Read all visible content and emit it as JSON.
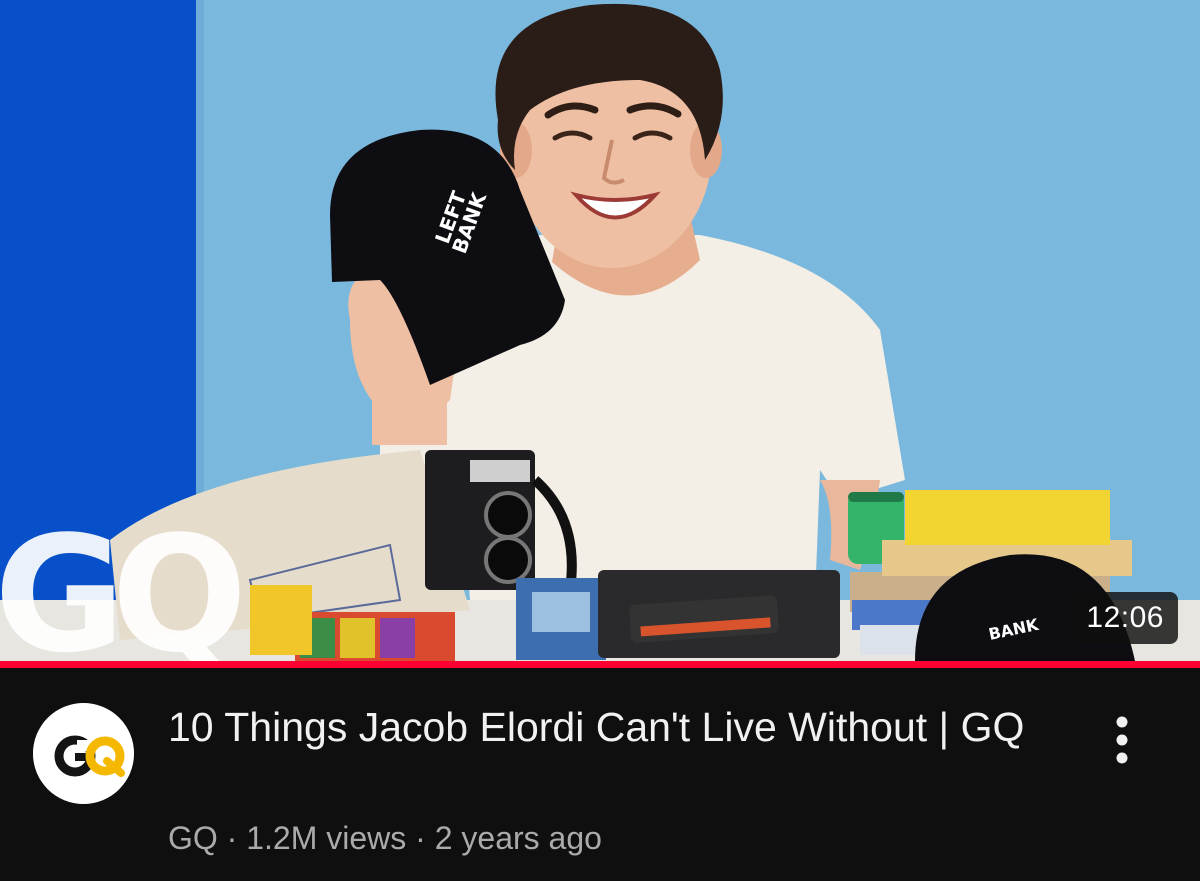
{
  "video": {
    "duration": "12:06",
    "progress_fraction": 1.0,
    "title": "10 Things Jacob Elordi Can't Live Without | GQ",
    "channel": "GQ",
    "separator": " · ",
    "views": "1.2M views",
    "age": "2 years ago"
  },
  "thumbnail": {
    "watermark_text": "GQ",
    "hat_text": "LEFT BANK BOOKS"
  },
  "channel_avatar": {
    "logo_text": "GQ"
  },
  "icons": {
    "more": "more-vertical-icon"
  },
  "colors": {
    "background": "#0f0f0f",
    "progress": "#ff0033",
    "title": "#f1f1f1",
    "subtext": "#aaaaaa",
    "backdrop_blue": "#7ab8dd",
    "panel_blue": "#0750c9",
    "gq_gold": "#f5b800"
  }
}
